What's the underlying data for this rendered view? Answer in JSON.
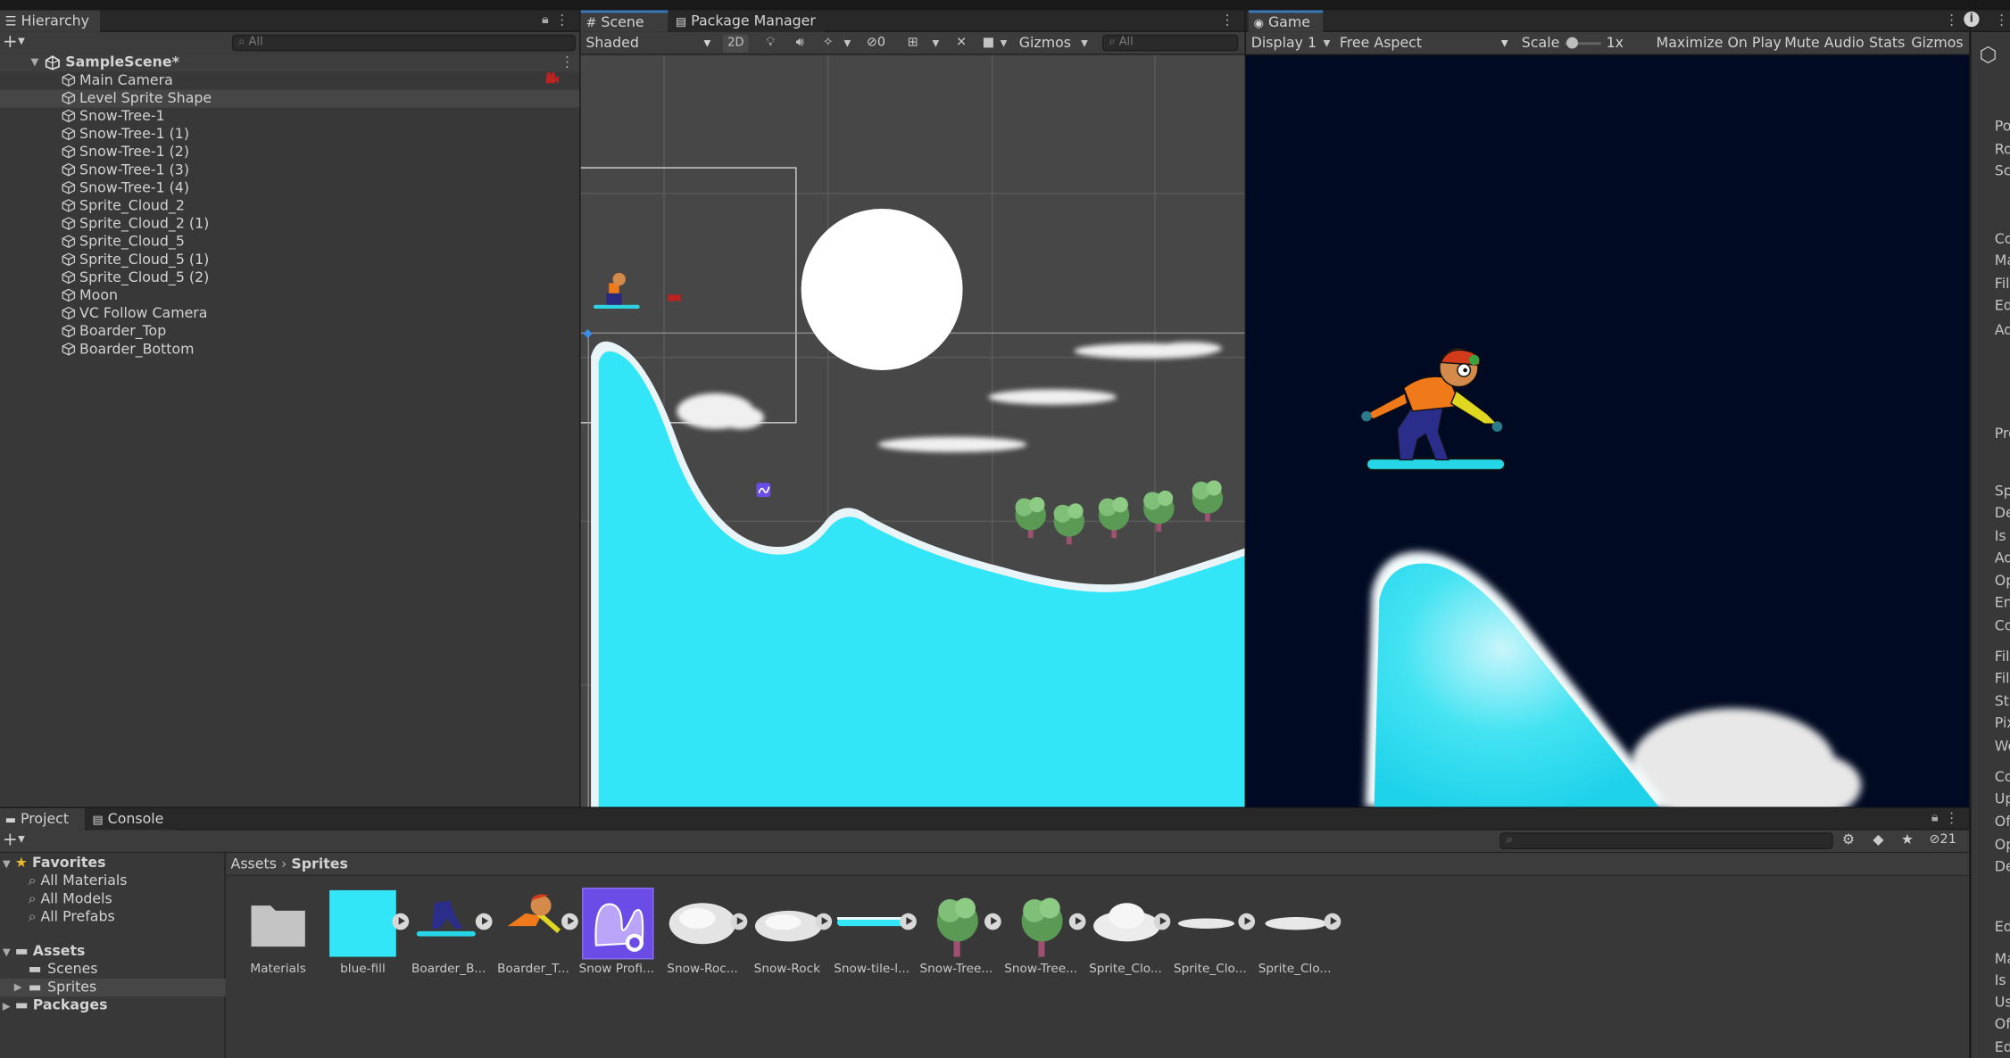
{
  "hierarchy": {
    "tab_label": "Hierarchy",
    "search_placeholder": "All",
    "scene_name": "SampleScene*",
    "items": [
      {
        "label": "Main Camera"
      },
      {
        "label": "Level Sprite Shape"
      },
      {
        "label": "Snow-Tree-1"
      },
      {
        "label": "Snow-Tree-1 (1)"
      },
      {
        "label": "Snow-Tree-1 (2)"
      },
      {
        "label": "Snow-Tree-1 (3)"
      },
      {
        "label": "Snow-Tree-1 (4)"
      },
      {
        "label": "Sprite_Cloud_2"
      },
      {
        "label": "Sprite_Cloud_2 (1)"
      },
      {
        "label": "Sprite_Cloud_5"
      },
      {
        "label": "Sprite_Cloud_5 (1)"
      },
      {
        "label": "Sprite_Cloud_5 (2)"
      },
      {
        "label": "Moon"
      },
      {
        "label": "VC Follow Camera"
      },
      {
        "label": "Boarder_Top"
      },
      {
        "label": "Boarder_Bottom"
      }
    ]
  },
  "scene": {
    "tab_scene": "Scene",
    "tab_package_manager": "Package Manager",
    "shading_mode": "Shaded",
    "mode_2d": "2D",
    "hidden_count": "0",
    "gizmos_label": "Gizmos",
    "search_placeholder": "All"
  },
  "game": {
    "tab_label": "Game",
    "display": "Display 1",
    "aspect": "Free Aspect",
    "scale_label": "Scale",
    "scale_value": "1x",
    "maximize_on_play": "Maximize On Play",
    "mute_audio": "Mute Audio",
    "stats": "Stats",
    "gizmos": "Gizmos"
  },
  "inspector": {
    "fragments": [
      "Po",
      "Ro",
      "Sc",
      "Co",
      "Ma",
      "Fil",
      "Ed",
      "Ad",
      "Pro",
      "Sp",
      "De",
      "Is",
      "Ad",
      "Op",
      "En",
      "Co",
      "Fil",
      "Fil",
      "Str",
      "Pix",
      "Wo",
      "Co",
      "Up",
      "Off",
      "Op",
      "De",
      "Ed",
      "Ma",
      "Is T",
      "Us",
      "Off",
      "Ed"
    ]
  },
  "project": {
    "tab_project": "Project",
    "tab_console": "Console",
    "favorites_label": "Favorites",
    "favorites": [
      "All Materials",
      "All Models",
      "All Prefabs"
    ],
    "assets_label": "Assets",
    "asset_folders": [
      "Scenes",
      "Sprites"
    ],
    "packages_label": "Packages",
    "breadcrumb_root": "Assets",
    "breadcrumb_current": "Sprites",
    "hidden_count": "21",
    "assets": [
      {
        "label": "Materials"
      },
      {
        "label": "blue-fill"
      },
      {
        "label": "Boarder_B..."
      },
      {
        "label": "Boarder_T..."
      },
      {
        "label": "Snow Profi..."
      },
      {
        "label": "Snow-Roc..."
      },
      {
        "label": "Snow-Rock"
      },
      {
        "label": "Snow-tile-l..."
      },
      {
        "label": "Snow-Tree..."
      },
      {
        "label": "Snow-Tree..."
      },
      {
        "label": "Sprite_Clo..."
      },
      {
        "label": "Sprite_Clo..."
      },
      {
        "label": "Sprite_Clo..."
      }
    ]
  },
  "colors": {
    "snow_fill": "#33e6f7",
    "game_bg": "#000a22",
    "scene_bg": "#474747",
    "selection": "#464646",
    "tab_accent": "#3a79bb"
  }
}
